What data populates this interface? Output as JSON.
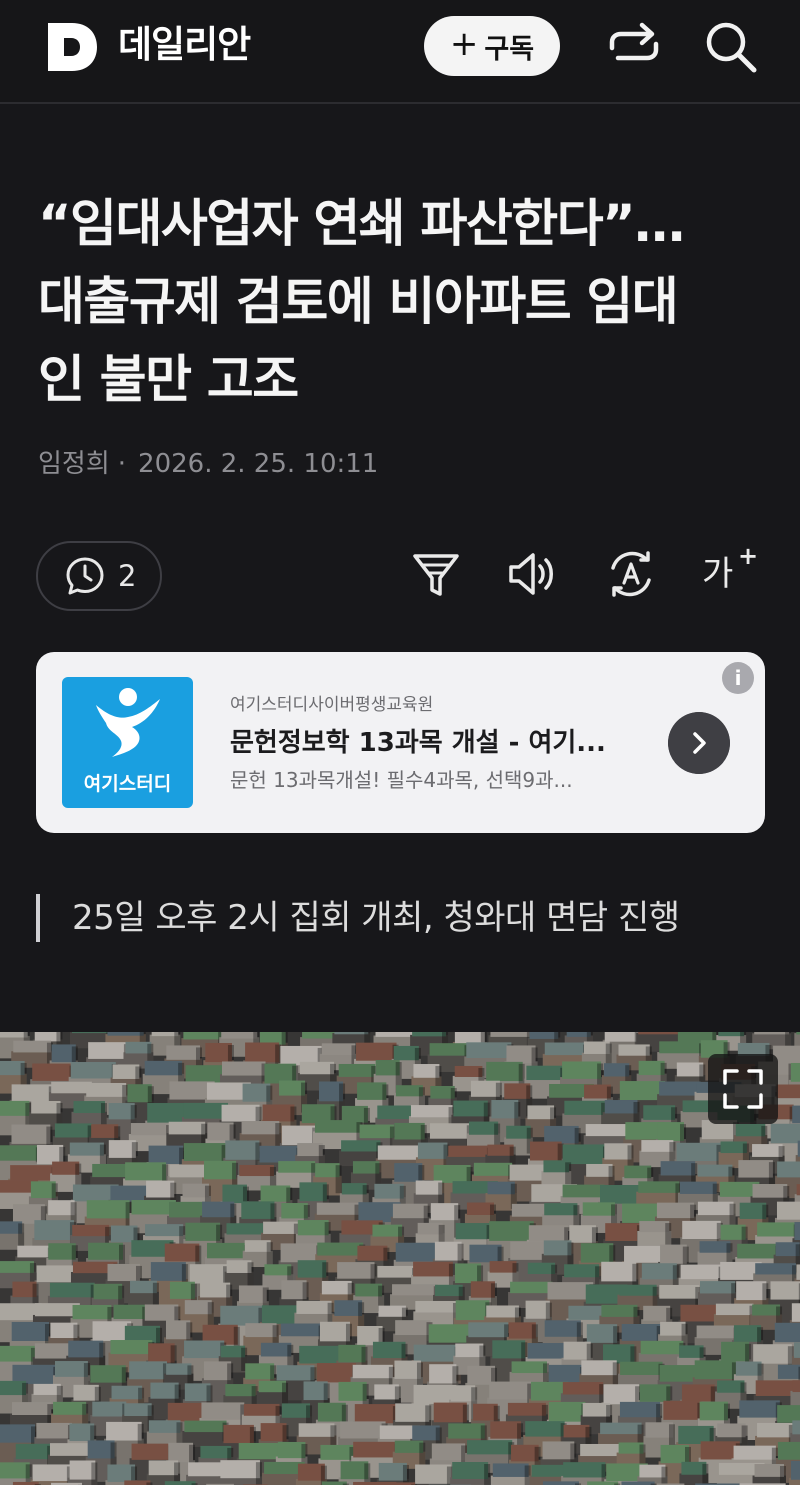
{
  "header": {
    "logo_letter": "D",
    "brand": "데일리안",
    "subscribe_plus": "+",
    "subscribe_label": "구독"
  },
  "article": {
    "headline_lines": [
      "“임대사업자 연쇄 파산한다”…",
      "대출규제 검토에 비아파트 임대",
      "인 불만 고조"
    ],
    "author": "임정희",
    "separator": "·",
    "datetime": "2026. 2. 25. 10:11",
    "subheadline": "25일 오후 2시 집회 개최, 청와대 면담 진행"
  },
  "toolbar": {
    "comment_count": "2",
    "font_size_glyph": "가",
    "font_size_plus": "+"
  },
  "ad": {
    "logo_text": "여기스터디",
    "sponsor": "여기스터디사이버평생교육원",
    "title": "문헌정보학 13과목 개설 - 여기...",
    "description": "문헌 13과목개설! 필수4과목, 선택9과...",
    "info_glyph": "i"
  },
  "colors": {
    "background": "#17171a",
    "ad_background": "#f2f2f4",
    "ad_logo_blue": "#1a9fe0",
    "meta_gray": "#8e8e93"
  },
  "icons": {
    "share": "share-icon",
    "search": "search-icon",
    "comment": "comment-icon",
    "filter": "filter-icon",
    "audio": "speaker-icon",
    "translate": "translate-icon",
    "expand": "expand-icon"
  }
}
